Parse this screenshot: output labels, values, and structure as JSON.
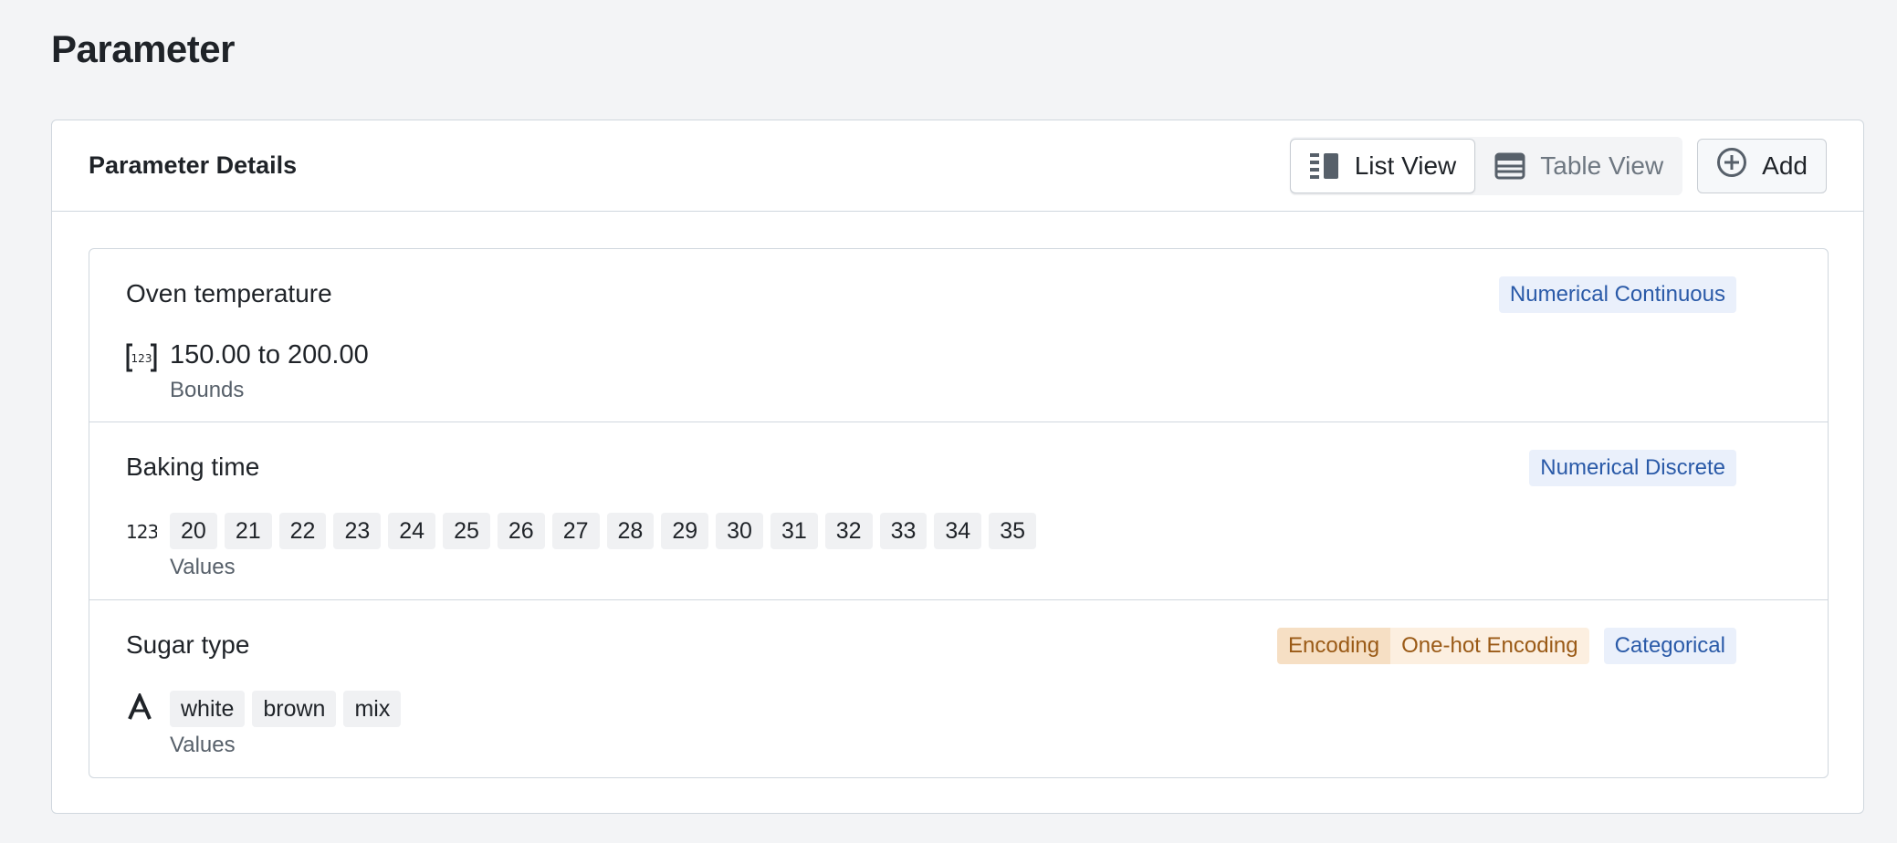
{
  "page": {
    "title": "Parameter"
  },
  "panel": {
    "title": "Parameter Details",
    "list_view_label": "List View",
    "table_view_label": "Table View",
    "add_label": "Add",
    "active_view": "list"
  },
  "parameters": [
    {
      "name": "Oven temperature",
      "type_badge": "Numerical Continuous",
      "icon": "bounds-123-icon",
      "bounds": "150.00 to 200.00",
      "sublabel": "Bounds"
    },
    {
      "name": "Baking time",
      "type_badge": "Numerical Discrete",
      "icon": "numeric-123-icon",
      "values": [
        "20",
        "21",
        "22",
        "23",
        "24",
        "25",
        "26",
        "27",
        "28",
        "29",
        "30",
        "31",
        "32",
        "33",
        "34",
        "35"
      ],
      "sublabel": "Values"
    },
    {
      "name": "Sugar type",
      "encoding_label": "Encoding",
      "encoding_value": "One-hot Encoding",
      "type_badge": "Categorical",
      "icon": "text-a-icon",
      "values": [
        "white",
        "brown",
        "mix"
      ],
      "sublabel": "Values"
    }
  ],
  "colors": {
    "badge_blue_bg": "#eaf0fb",
    "badge_blue_text": "#2a5aa8",
    "badge_orange_text": "#9a5a16"
  }
}
